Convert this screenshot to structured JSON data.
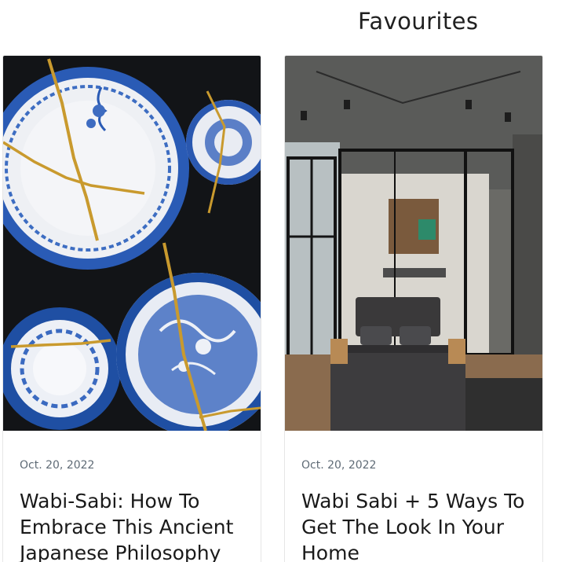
{
  "section": {
    "title": "Favourites"
  },
  "cards": [
    {
      "image_alt": "Blue and white porcelain plates repaired with gold kintsugi",
      "date": "Oct. 20, 2022",
      "title_lines": [
        "Wabi-Sabi: How To",
        "Embrace This Ancient",
        "Japanese Philosophy"
      ]
    },
    {
      "image_alt": "Minimal bedroom with glass partitions and dark bed",
      "date": "Oct. 20, 2022",
      "title_lines": [
        "Wabi Sabi + 5 Ways To",
        "Get The  Look  In Your",
        "Home"
      ]
    }
  ],
  "colors": {
    "date_text": "#5f6b76",
    "title_text": "#1a1a1a",
    "card_border": "#e6e6e6",
    "porcelain_blue": "#1f4fa3",
    "kintsugi_gold": "#c99a2e"
  }
}
